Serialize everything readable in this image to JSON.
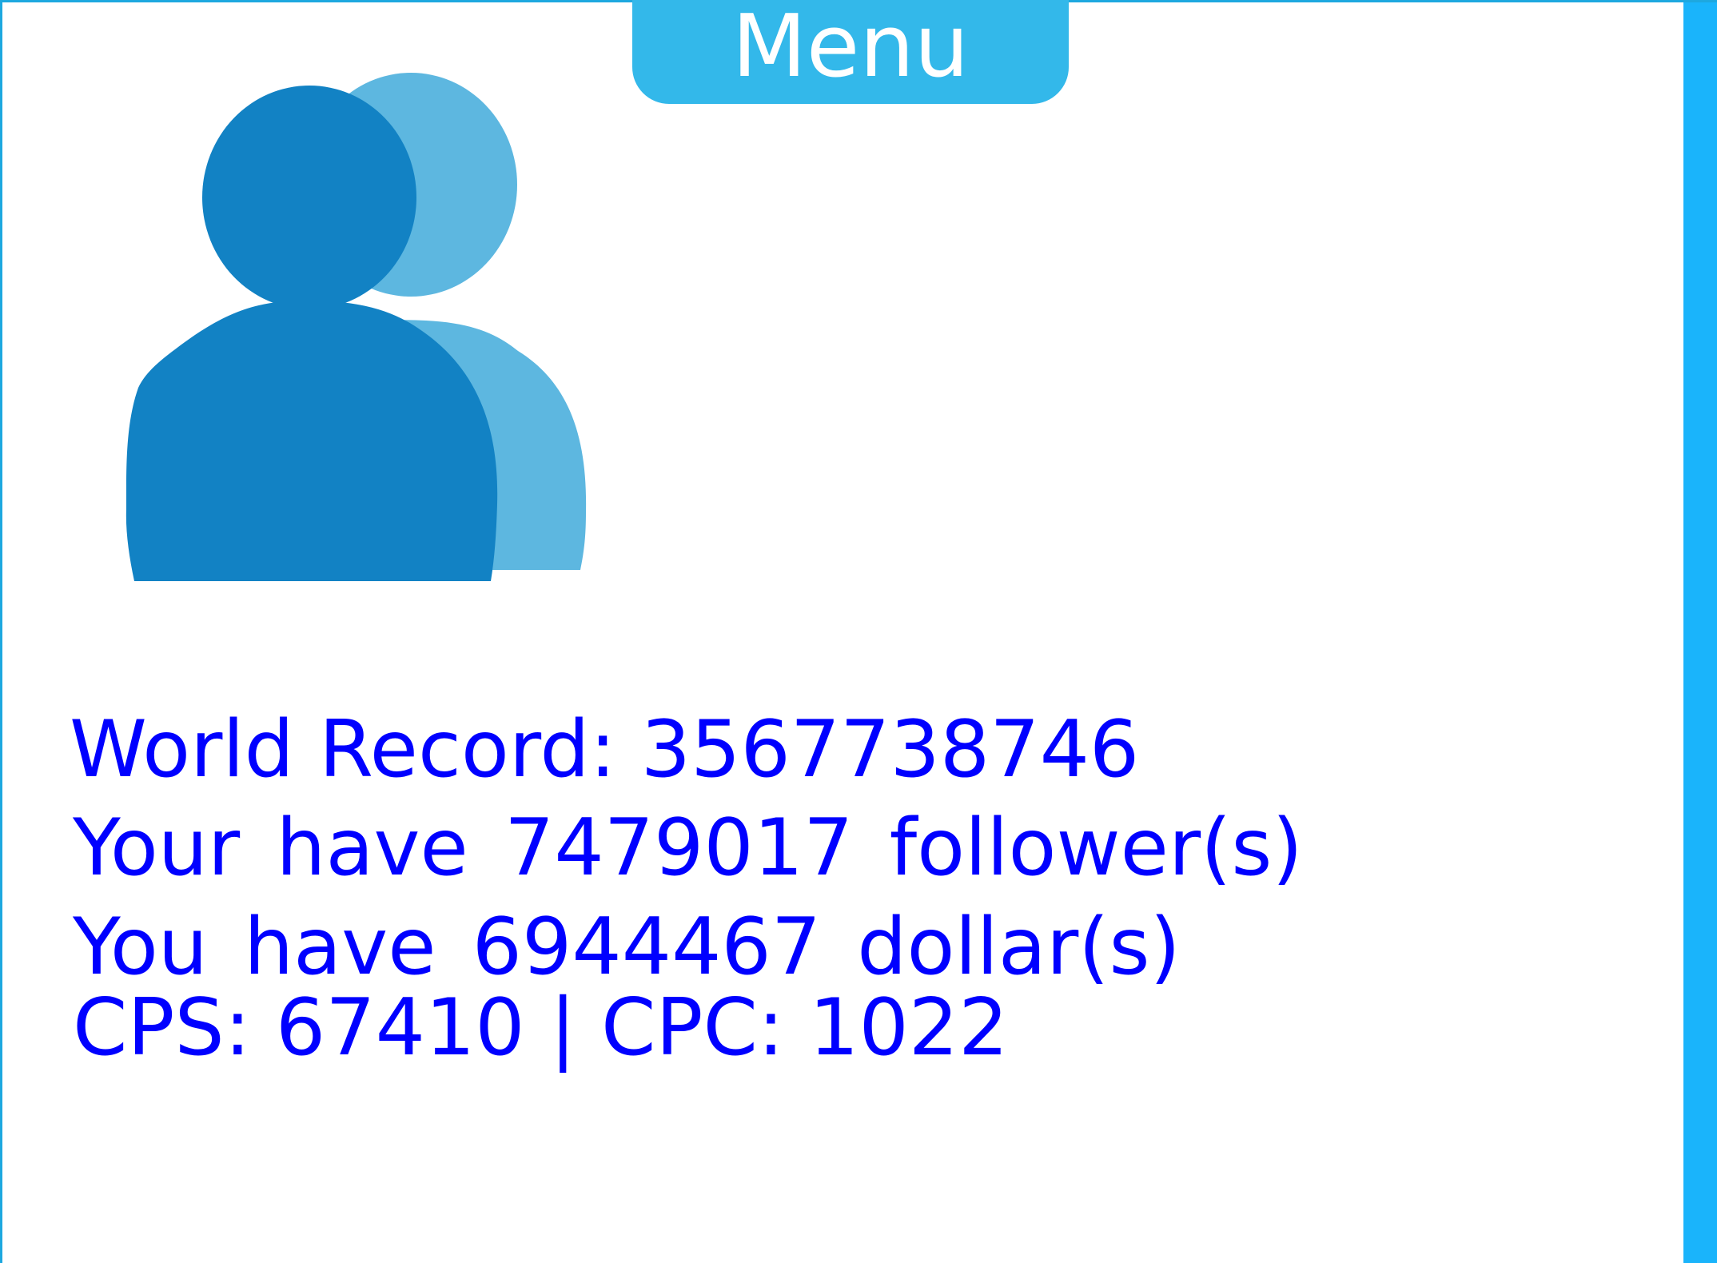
{
  "menu": {
    "label": "Menu"
  },
  "clicker": {
    "icon": "followers-icon",
    "colors": {
      "front": "#1282c4",
      "back": "#5db7e0"
    }
  },
  "stats": {
    "world_record": "World Record: 3567738746",
    "followers": "Your have 7479017 follower(s)",
    "dollars": "You have 6944467 dollar(s)",
    "cps_cpc": "CPS: 67410 | CPC: 1022"
  },
  "colors": {
    "accent": "#33b8ea",
    "side_bar": "#1ab4fb",
    "stat_text": "#0000ff"
  }
}
